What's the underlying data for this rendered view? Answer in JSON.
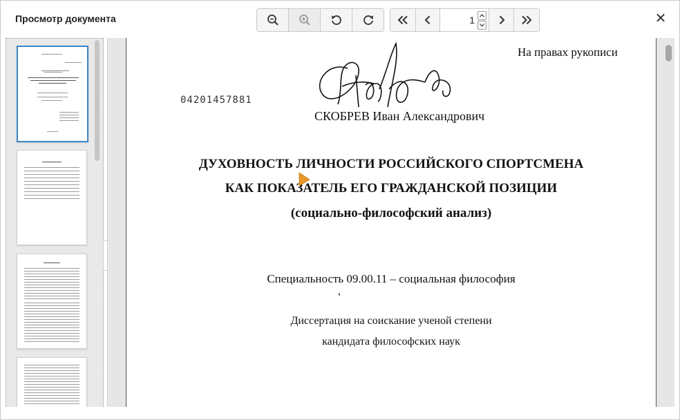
{
  "window": {
    "title": "Просмотр документа",
    "close_glyph": "✕"
  },
  "toolbar": {
    "zoom_out_icon": "zoom-out-icon",
    "zoom_in_icon": "zoom-in-icon",
    "rotate_left_icon": "rotate-left-icon",
    "rotate_right_icon": "rotate-right-icon",
    "first_page_icon": "first-page-icon",
    "prev_page_icon": "prev-page-icon",
    "next_page_icon": "next-page-icon",
    "last_page_icon": "last-page-icon",
    "page_number": "1"
  },
  "document": {
    "rights_note": "На правах рукописи",
    "doc_code": "04201457881",
    "author": "СКОБРЕВ Иван Александрович",
    "title_line1": "ДУХОВНОСТЬ ЛИЧНОСТИ РОССИЙСКОГО СПОРТСМЕНА",
    "title_line2": "КАК ПОКАЗАТЕЛЬ ЕГО ГРАЖДАНСКОЙ ПОЗИЦИИ",
    "subtitle": "(социально-философский анализ)",
    "specialty": "Специальность 09.00.11 – социальная философия",
    "degree_line1": "Диссертация на соискание ученой степени",
    "degree_line2": "кандидата философских наук"
  },
  "colors": {
    "accent": "#3a87c8",
    "cursor": "#e8962a",
    "panel_bg": "#e9e9e9",
    "viewer_bg": "#e6e6e6"
  }
}
